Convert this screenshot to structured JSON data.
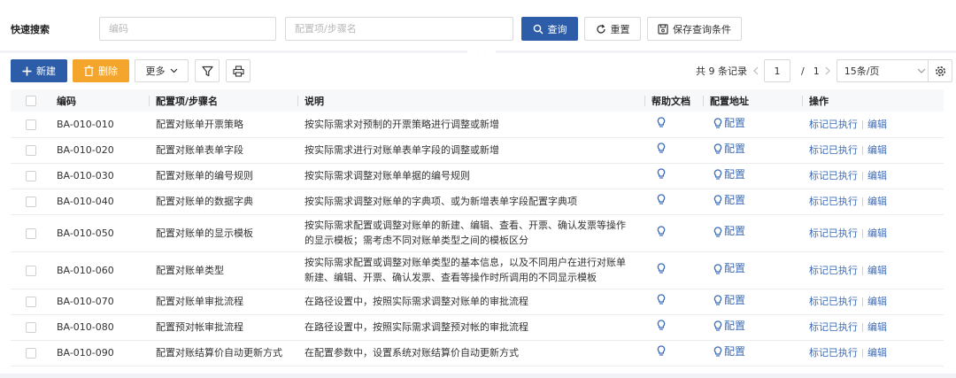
{
  "search": {
    "title": "快速搜索",
    "code_placeholder": "编码",
    "item_placeholder": "配置项/步骤名",
    "query_label": "查询",
    "reset_label": "重置",
    "save_label": "保存查询条件"
  },
  "toolbar": {
    "new_label": "新建",
    "delete_label": "删除",
    "more_label": "更多"
  },
  "pagination": {
    "total": "共 9 条记录",
    "current_page": "1",
    "slash": "/",
    "total_pages": "1",
    "page_size": "15条/页"
  },
  "table": {
    "columns": [
      "编码",
      "配置项/步骤名",
      "说明",
      "帮助文档",
      "配置地址",
      "操作"
    ],
    "config_label": "配置",
    "op_mark": "标记已执行",
    "op_edit": "编辑",
    "rows": [
      {
        "code": "BA-010-010",
        "name": "配置对账单开票策略",
        "desc": "按实际需求对预制的开票策略进行调整或新增"
      },
      {
        "code": "BA-010-020",
        "name": "配置对账单表单字段",
        "desc": "按实际需求进行对账单表单字段的调整或新增"
      },
      {
        "code": "BA-010-030",
        "name": "配置对账单的编号规则",
        "desc": "按实际需求调整对账单单据的编号规则"
      },
      {
        "code": "BA-010-040",
        "name": "配置对账单的数据字典",
        "desc": "按实际需求调整对账单的字典项、或为新增表单字段配置字典项"
      },
      {
        "code": "BA-010-050",
        "name": "配置对账单的显示模板",
        "desc": "按实际需求配置或调整对账单的新建、编辑、查看、开票、确认发票等操作的显示模板；需考虑不同对账单类型之间的模板区分"
      },
      {
        "code": "BA-010-060",
        "name": "配置对账单类型",
        "desc": "按实际需求配置或调整对账单类型的基本信息，以及不同用户在进行对账单新建、编辑、开票、确认发票、查看等操作时所调用的不同显示模板"
      },
      {
        "code": "BA-010-070",
        "name": "配置对账单审批流程",
        "desc": "在路径设置中，按照实际需求调整对账单的审批流程"
      },
      {
        "code": "BA-010-080",
        "name": "配置预对帐审批流程",
        "desc": "在路径设置中，按照实际需求调整预对帐的审批流程"
      },
      {
        "code": "BA-010-090",
        "name": "配置对账结算价自动更新方式",
        "desc": "在配置参数中，设置系统对账结算价自动更新方式"
      }
    ]
  },
  "colors": {
    "primary": "#2d5da8",
    "warning": "#f3a52c",
    "link": "#3d6cb9"
  }
}
